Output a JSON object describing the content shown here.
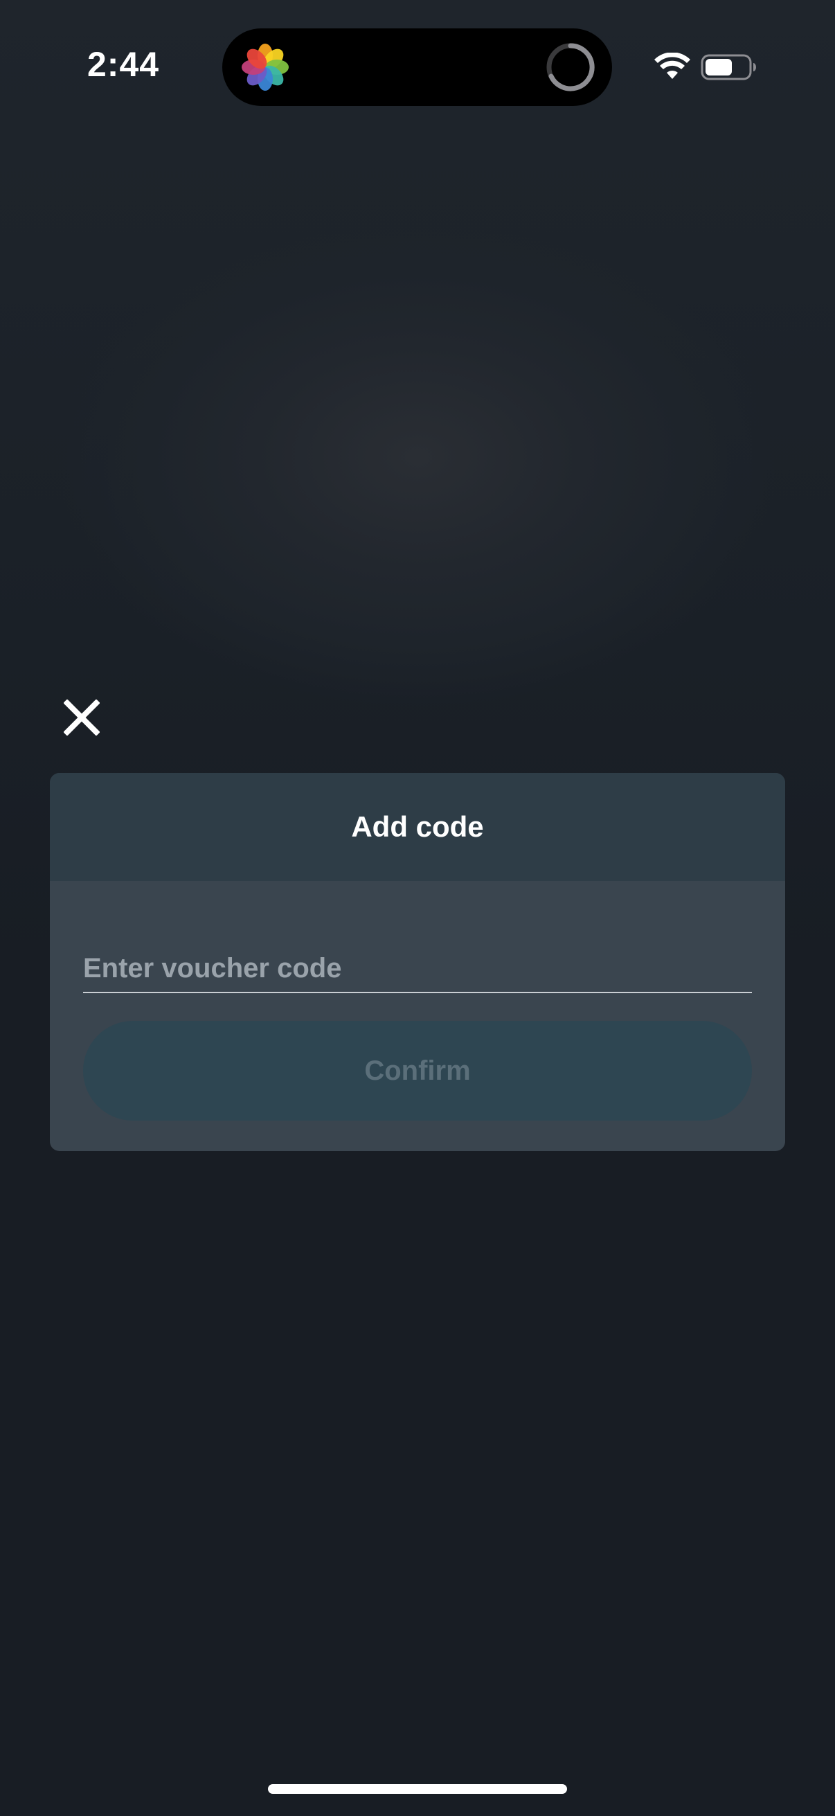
{
  "status_bar": {
    "time": "2:44",
    "icons": [
      "photos-app-icon",
      "activity-ring-icon",
      "wifi-icon",
      "battery-icon"
    ]
  },
  "dialog": {
    "close_icon": "close-icon",
    "title": "Add code",
    "voucher_placeholder": "Enter voucher code",
    "voucher_value": "",
    "confirm_label": "Confirm"
  },
  "colors": {
    "background": "#181d24",
    "card": "#3a454f",
    "card_header": "#2e3d47",
    "confirm_button": "#2e4652",
    "confirm_text": "#5b6f7a"
  }
}
